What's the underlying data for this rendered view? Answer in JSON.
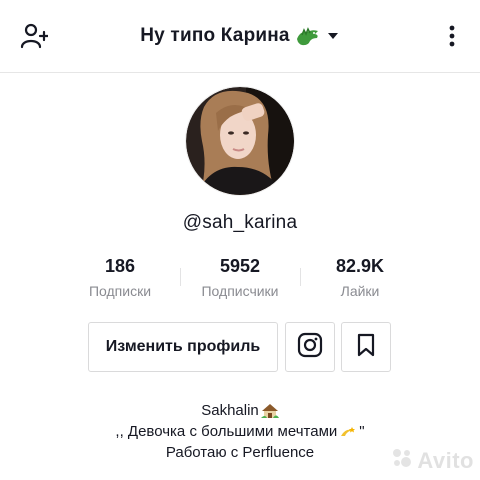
{
  "header": {
    "title": "Ну типо Карина",
    "title_emoji": "dragon-icon",
    "left_icon": "add-user-icon",
    "right_icon": "more-vertical-icon",
    "dropdown_icon": "caret-down-icon"
  },
  "profile": {
    "username": "@sah_karina",
    "avatar": "profile-photo"
  },
  "stats": [
    {
      "value": "186",
      "label": "Подписки"
    },
    {
      "value": "5952",
      "label": "Подписчики"
    },
    {
      "value": "82.9K",
      "label": "Лайки"
    }
  ],
  "actions": {
    "edit_profile": "Изменить профиль",
    "instagram_icon": "instagram-icon",
    "bookmark_icon": "bookmark-icon"
  },
  "bio": {
    "line1": "Sakhalin",
    "line1_emoji": "house-icon",
    "line2_prefix": ",, Девочка с большими мечтами",
    "line2_emoji": "dizzy-icon",
    "line2_suffix": "\"",
    "line3": "Работаю с Perfluence"
  },
  "watermark": {
    "text": "Avito"
  },
  "colors": {
    "text": "#161823",
    "secondary": "#8a8b91",
    "border": "#dadadb"
  }
}
